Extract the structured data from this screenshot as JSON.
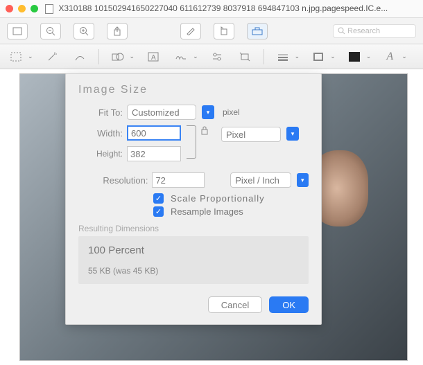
{
  "window": {
    "title": "X310188 101502941650227040 611612739 8037918 694847103 n.jpg.pagespeed.IC.e..."
  },
  "search": {
    "placeholder": "Research"
  },
  "dialog": {
    "title": "Image Size",
    "fit_to_label": "Fit To:",
    "fit_to_value": "Customized",
    "fit_unit": "pixel",
    "width_label": "Width:",
    "width_value": "600",
    "width_unit": "Pixel",
    "height_label": "Height:",
    "height_value": "382",
    "resolution_label": "Resolution:",
    "resolution_value": "72",
    "resolution_unit": "Pixel / Inch",
    "scale_label": "Scale Proportionally",
    "resample_label": "Resample Images",
    "resulting_label": "Resulting Dimensions",
    "percent": "100 Percent",
    "size": "55 KB (was 45 KB)",
    "cancel": "Cancel",
    "ok": "OK"
  }
}
